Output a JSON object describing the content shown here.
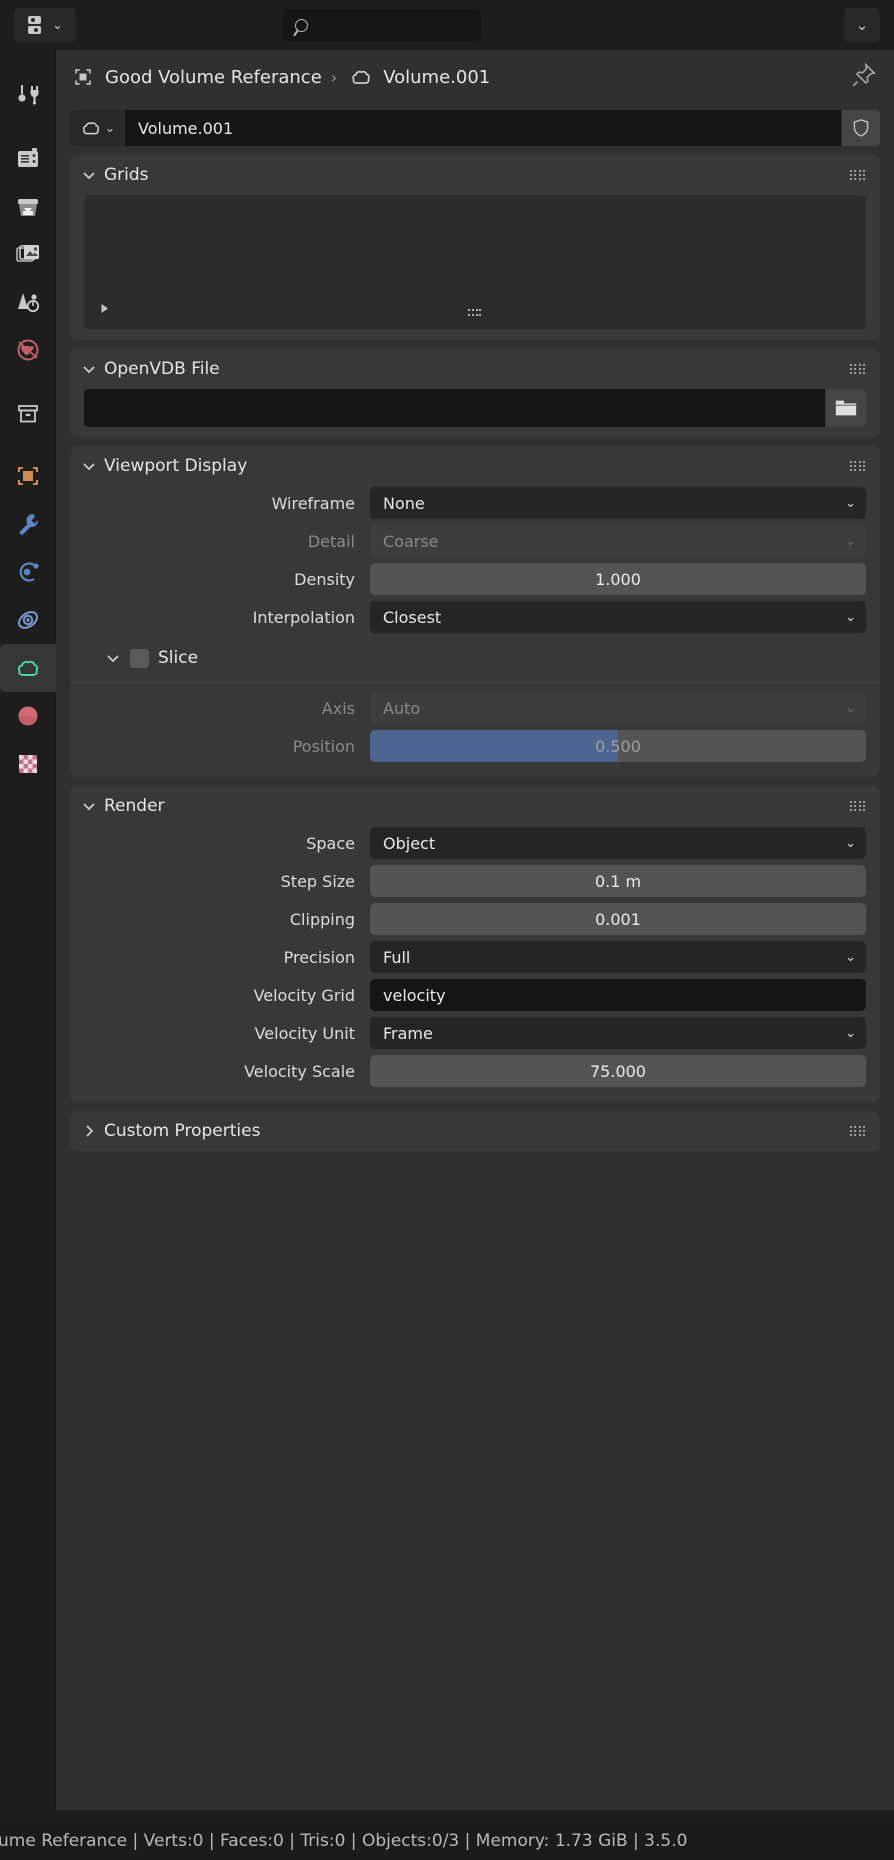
{
  "topbar": {
    "editor_type_icon": "editor-type-properties-icon",
    "editor_type_chevron": "⌄",
    "search": {
      "value": "",
      "placeholder": "",
      "icon": "search-icon"
    },
    "options_chevron": "⌄"
  },
  "tabs": [
    {
      "name": "tool",
      "icon": "tool-icon",
      "active": false
    },
    {
      "name": "render",
      "icon": "camera-back-icon",
      "active": false
    },
    {
      "name": "output",
      "icon": "printer-icon",
      "active": false
    },
    {
      "name": "view-layer",
      "icon": "images-icon",
      "active": false
    },
    {
      "name": "scene",
      "icon": "scene-cone-icon",
      "active": false
    },
    {
      "name": "world",
      "icon": "world-globe-icon",
      "active": false
    },
    {
      "name": "collection",
      "icon": "collection-box-icon",
      "active": false
    },
    {
      "name": "object",
      "icon": "object-square-icon",
      "active": false
    },
    {
      "name": "modifiers",
      "icon": "wrench-icon",
      "active": false
    },
    {
      "name": "particles",
      "icon": "particles-icon",
      "active": false
    },
    {
      "name": "physics",
      "icon": "physics-orbit-icon",
      "active": false
    },
    {
      "name": "object-data-volume",
      "icon": "volume-cloud-icon",
      "active": true
    },
    {
      "name": "material",
      "icon": "material-sphere-icon",
      "active": false
    },
    {
      "name": "texture",
      "icon": "texture-checker-icon",
      "active": false
    }
  ],
  "breadcrumb": {
    "object_icon": "object-square-icon",
    "object_name": "Good Volume Referance",
    "separator": "›",
    "data_icon": "volume-cloud-icon",
    "data_name": "Volume.001",
    "pin_icon": "pin-icon"
  },
  "datablock": {
    "id_icon": "volume-cloud-icon",
    "id_chevron": "⌄",
    "name": "Volume.001",
    "fake_user_icon": "shield-icon"
  },
  "panels": {
    "grids": {
      "title": "Grids",
      "expanded": true,
      "collapse_chevron": "⌄",
      "list_items": [],
      "filter_arrow": "▶"
    },
    "openvdb_file": {
      "title": "OpenVDB File",
      "expanded": true,
      "collapse_chevron": "⌄",
      "filepath": "",
      "browse_icon": "folder-icon"
    },
    "viewport_display": {
      "title": "Viewport Display",
      "expanded": true,
      "collapse_chevron": "⌄",
      "rows": [
        {
          "label": "Wireframe",
          "value": "None",
          "type": "dropdown",
          "disabled": false
        },
        {
          "label": "Detail",
          "value": "Coarse",
          "type": "dropdown",
          "disabled": true
        },
        {
          "label": "Density",
          "value": "1.000",
          "type": "slider",
          "disabled": false,
          "fill_pct": 0
        },
        {
          "label": "Interpolation",
          "value": "Closest",
          "type": "dropdown",
          "disabled": false
        }
      ],
      "slice": {
        "title": "Slice",
        "enabled": false,
        "collapse_chevron": "⌄",
        "rows": [
          {
            "label": "Axis",
            "value": "Auto",
            "type": "dropdown",
            "disabled": true
          },
          {
            "label": "Position",
            "value": "0.500",
            "type": "slider",
            "disabled": true,
            "fill_pct": 50
          }
        ]
      }
    },
    "render": {
      "title": "Render",
      "expanded": true,
      "collapse_chevron": "⌄",
      "rows": [
        {
          "label": "Space",
          "value": "Object",
          "type": "dropdown",
          "disabled": false
        },
        {
          "label": "Step Size",
          "value": "0.1 m",
          "type": "slider",
          "disabled": false,
          "fill_pct": 0
        },
        {
          "label": "Clipping",
          "value": "0.001",
          "type": "slider",
          "disabled": false,
          "fill_pct": 0
        },
        {
          "label": "Precision",
          "value": "Full",
          "type": "dropdown",
          "disabled": false
        },
        {
          "label": "Velocity Grid",
          "value": "velocity",
          "type": "text",
          "disabled": false
        },
        {
          "label": "Velocity Unit",
          "value": "Frame",
          "type": "dropdown",
          "disabled": false
        },
        {
          "label": "Velocity Scale",
          "value": "75.000",
          "type": "slider",
          "disabled": false,
          "fill_pct": 0
        }
      ]
    },
    "custom_properties": {
      "title": "Custom Properties",
      "expanded": false,
      "collapse_chevron": "›"
    }
  },
  "statusbar": {
    "text": "ume Referance | Verts:0 | Faces:0 | Tris:0 | Objects:0/3 | Memory: 1.73 GiB | 3.5.0"
  },
  "colors": {
    "background": "#1d1d1d",
    "panel": "#383838",
    "region": "#303030",
    "field_dark": "#151515",
    "field_slider": "#545454",
    "slider_fill_blue": "#4c6490",
    "accent_world": "#c4606b",
    "accent_object": "#d08b50",
    "accent_modifier": "#5b84c4",
    "accent_volume": "#4bd8a0",
    "text": "#e6e6e6",
    "text_dim": "#8a8a8a"
  }
}
